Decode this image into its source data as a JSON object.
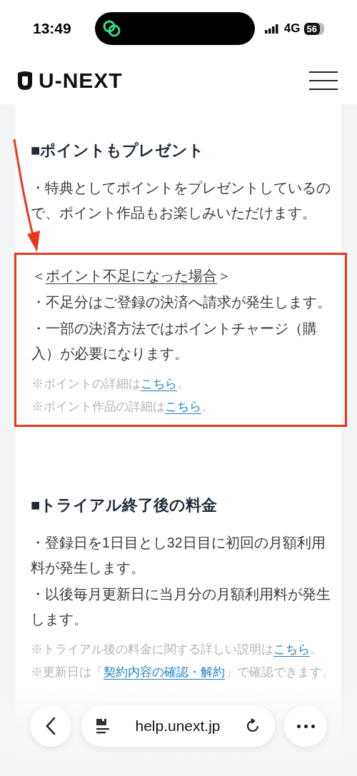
{
  "status_bar": {
    "time": "13:49",
    "network": "4G",
    "battery": "56"
  },
  "header": {
    "logo": "U-NEXT"
  },
  "sections": [
    {
      "heading": "■ポイントもプレゼント",
      "blocks": [
        {
          "kind": "body",
          "segments": [
            {
              "kind": "text",
              "text": "・特典としてポイントをプレゼントしているので、ポイント作品もお楽しみいただけます。"
            }
          ]
        }
      ]
    },
    {
      "highlighted": true,
      "blocks": [
        {
          "kind": "body",
          "segments": [
            {
              "kind": "text",
              "text": "＜"
            },
            {
              "kind": "underline",
              "text": "ポイント不足になった場合"
            },
            {
              "kind": "text",
              "text": "＞"
            }
          ]
        },
        {
          "kind": "body",
          "segments": [
            {
              "kind": "text",
              "text": "・不足分はご登録の決済へ請求が発生します。"
            }
          ]
        },
        {
          "kind": "body",
          "segments": [
            {
              "kind": "text",
              "text": "・一部の決済方法ではポイントチャージ（購入）が必要になります。"
            }
          ]
        },
        {
          "kind": "note",
          "segments": [
            {
              "kind": "text",
              "text": "※ポイントの詳細は"
            },
            {
              "kind": "link",
              "text": "こちら"
            },
            {
              "kind": "text",
              "text": "。"
            }
          ]
        },
        {
          "kind": "note",
          "segments": [
            {
              "kind": "text",
              "text": "※ポイント作品の詳細は"
            },
            {
              "kind": "link",
              "text": "こちら"
            },
            {
              "kind": "text",
              "text": "。"
            }
          ]
        }
      ]
    },
    {
      "heading": "■トライアル終了後の料金",
      "blocks": [
        {
          "kind": "body",
          "segments": [
            {
              "kind": "text",
              "text": "・登録日を1日目とし32日目に初回の月額利用料が発生します。"
            }
          ]
        },
        {
          "kind": "body",
          "segments": [
            {
              "kind": "text",
              "text": "・以後毎月更新日に当月分の月額利用料が発生します。"
            }
          ]
        },
        {
          "kind": "note",
          "segments": [
            {
              "kind": "text",
              "text": "※トライアル後の料金に関する詳しい説明は"
            },
            {
              "kind": "link",
              "text": "こちら"
            },
            {
              "kind": "text",
              "text": "。"
            }
          ]
        },
        {
          "kind": "note",
          "segments": [
            {
              "kind": "text",
              "text": "※更新日は「"
            },
            {
              "kind": "link",
              "text": "契約内容の確認・解約"
            },
            {
              "kind": "text",
              "text": "」で確認できます。"
            }
          ]
        }
      ]
    }
  ],
  "browser_bar": {
    "url": "help.unext.jp"
  }
}
